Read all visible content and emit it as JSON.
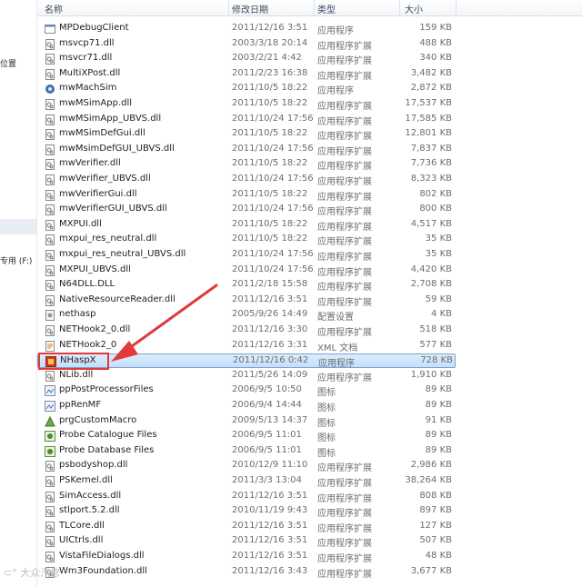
{
  "nav": {
    "items": [
      {
        "label": "位置"
      },
      {
        "label": "专用 (F:)"
      }
    ]
  },
  "header": {
    "name": "名称",
    "date": "修改日期",
    "type": "类型",
    "size": "大小"
  },
  "files": [
    {
      "name": "MPDebugClient",
      "date": "2011/12/16 3:51",
      "type": "应用程序",
      "size": "159 KB",
      "icon": "exe-icon"
    },
    {
      "name": "msvcp71.dll",
      "date": "2003/3/18 20:14",
      "type": "应用程序扩展",
      "size": "488 KB",
      "icon": "dll-icon"
    },
    {
      "name": "msvcr71.dll",
      "date": "2003/2/21 4:42",
      "type": "应用程序扩展",
      "size": "340 KB",
      "icon": "dll-icon"
    },
    {
      "name": "MultiXPost.dll",
      "date": "2011/2/23 16:38",
      "type": "应用程序扩展",
      "size": "3,482 KB",
      "icon": "dll-icon"
    },
    {
      "name": "mwMachSim",
      "date": "2011/10/5 18:22",
      "type": "应用程序",
      "size": "2,872 KB",
      "icon": "app-icon"
    },
    {
      "name": "mwMSimApp.dll",
      "date": "2011/10/5 18:22",
      "type": "应用程序扩展",
      "size": "17,537 KB",
      "icon": "dll-icon"
    },
    {
      "name": "mwMSimApp_UBVS.dll",
      "date": "2011/10/24 17:56",
      "type": "应用程序扩展",
      "size": "17,585 KB",
      "icon": "dll-icon"
    },
    {
      "name": "mwMSimDefGui.dll",
      "date": "2011/10/5 18:22",
      "type": "应用程序扩展",
      "size": "12,801 KB",
      "icon": "dll-icon"
    },
    {
      "name": "mwMsimDefGUI_UBVS.dll",
      "date": "2011/10/24 17:56",
      "type": "应用程序扩展",
      "size": "7,837 KB",
      "icon": "dll-icon"
    },
    {
      "name": "mwVerifier.dll",
      "date": "2011/10/5 18:22",
      "type": "应用程序扩展",
      "size": "7,736 KB",
      "icon": "dll-icon"
    },
    {
      "name": "mwVerifier_UBVS.dll",
      "date": "2011/10/24 17:56",
      "type": "应用程序扩展",
      "size": "8,323 KB",
      "icon": "dll-icon"
    },
    {
      "name": "mwVerifierGui.dll",
      "date": "2011/10/5 18:22",
      "type": "应用程序扩展",
      "size": "802 KB",
      "icon": "dll-icon"
    },
    {
      "name": "mwVerifierGUI_UBVS.dll",
      "date": "2011/10/24 17:56",
      "type": "应用程序扩展",
      "size": "800 KB",
      "icon": "dll-icon"
    },
    {
      "name": "MXPUI.dll",
      "date": "2011/10/5 18:22",
      "type": "应用程序扩展",
      "size": "4,517 KB",
      "icon": "dll-icon"
    },
    {
      "name": "mxpui_res_neutral.dll",
      "date": "2011/10/5 18:22",
      "type": "应用程序扩展",
      "size": "35 KB",
      "icon": "dll-icon"
    },
    {
      "name": "mxpui_res_neutral_UBVS.dll",
      "date": "2011/10/24 17:56",
      "type": "应用程序扩展",
      "size": "35 KB",
      "icon": "dll-icon"
    },
    {
      "name": "MXPUI_UBVS.dll",
      "date": "2011/10/24 17:56",
      "type": "应用程序扩展",
      "size": "4,420 KB",
      "icon": "dll-icon"
    },
    {
      "name": "N64DLL.DLL",
      "date": "2011/2/18 15:58",
      "type": "应用程序扩展",
      "size": "2,708 KB",
      "icon": "dll-icon"
    },
    {
      "name": "NativeResourceReader.dll",
      "date": "2011/12/16 3:51",
      "type": "应用程序扩展",
      "size": "59 KB",
      "icon": "dll-icon"
    },
    {
      "name": "nethasp",
      "date": "2005/9/26 14:49",
      "type": "配置设置",
      "size": "4 KB",
      "icon": "config-icon"
    },
    {
      "name": "NETHook2_0.dll",
      "date": "2011/12/16 3:30",
      "type": "应用程序扩展",
      "size": "518 KB",
      "icon": "dll-icon"
    },
    {
      "name": "NETHook2_0",
      "date": "2011/12/16 3:31",
      "type": "XML 文档",
      "size": "577 KB",
      "icon": "xml-icon"
    },
    {
      "name": "NHaspX",
      "date": "2011/12/16 0:42",
      "type": "应用程序",
      "size": "728 KB",
      "icon": "nhasp-icon",
      "selected": true
    },
    {
      "name": "NLib.dll",
      "date": "2011/5/26 14:09",
      "type": "应用程序扩展",
      "size": "1,910 KB",
      "icon": "dll-icon"
    },
    {
      "name": "ppPostProcessorFiles",
      "date": "2006/9/5 10:50",
      "type": "图标",
      "size": "89 KB",
      "icon": "ico-icon"
    },
    {
      "name": "ppRenMF",
      "date": "2006/9/4 14:44",
      "type": "图标",
      "size": "89 KB",
      "icon": "ico-icon"
    },
    {
      "name": "prgCustomMacro",
      "date": "2009/5/13 14:37",
      "type": "图标",
      "size": "91 KB",
      "icon": "macro-icon"
    },
    {
      "name": "Probe Catalogue Files",
      "date": "2006/9/5 11:01",
      "type": "图标",
      "size": "89 KB",
      "icon": "probe-icon"
    },
    {
      "name": "Probe Database Files",
      "date": "2006/9/5 11:01",
      "type": "图标",
      "size": "89 KB",
      "icon": "probe-icon"
    },
    {
      "name": "psbodyshop.dll",
      "date": "2010/12/9 11:10",
      "type": "应用程序扩展",
      "size": "2,986 KB",
      "icon": "dll-icon"
    },
    {
      "name": "PSKernel.dll",
      "date": "2011/3/3 13:04",
      "type": "应用程序扩展",
      "size": "38,264 KB",
      "icon": "dll-icon"
    },
    {
      "name": "SimAccess.dll",
      "date": "2011/12/16 3:51",
      "type": "应用程序扩展",
      "size": "808 KB",
      "icon": "dll-icon"
    },
    {
      "name": "stlport.5.2.dll",
      "date": "2010/11/19 9:43",
      "type": "应用程序扩展",
      "size": "897 KB",
      "icon": "dll-icon"
    },
    {
      "name": "TLCore.dll",
      "date": "2011/12/16 3:51",
      "type": "应用程序扩展",
      "size": "127 KB",
      "icon": "dll-icon"
    },
    {
      "name": "UICtrls.dll",
      "date": "2011/12/16 3:51",
      "type": "应用程序扩展",
      "size": "507 KB",
      "icon": "dll-icon"
    },
    {
      "name": "VistaFileDialogs.dll",
      "date": "2011/12/16 3:51",
      "type": "应用程序扩展",
      "size": "48 KB",
      "icon": "dll-icon"
    },
    {
      "name": "Wm3Foundation.dll",
      "date": "2011/12/16 3:43",
      "type": "应用程序扩展",
      "size": "3,677 KB",
      "icon": "dll-icon"
    }
  ],
  "watermark": "大众汽修",
  "colors": {
    "selection": "#cce4fb",
    "annotation": "#e03a3a"
  }
}
